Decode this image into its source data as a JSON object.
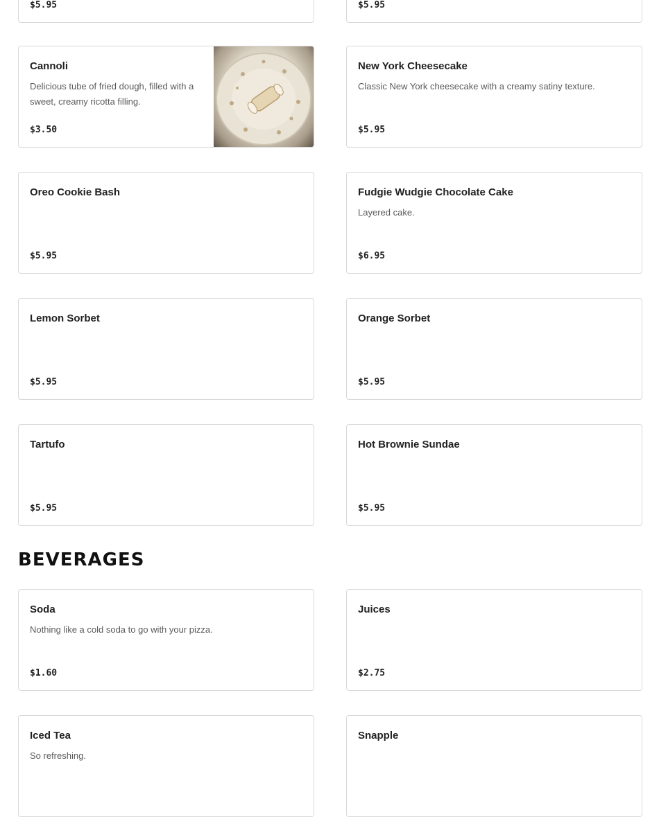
{
  "desserts": {
    "items": [
      {
        "name": "",
        "description": "",
        "price": "$5.95"
      },
      {
        "name": "",
        "description": "",
        "price": "$5.95"
      },
      {
        "name": "Cannoli",
        "description": "Delicious tube of fried dough, filled with a sweet, creamy ricotta filling.",
        "price": "$3.50"
      },
      {
        "name": "New York Cheesecake",
        "description": "Classic New York cheesecake with a creamy satiny texture.",
        "price": "$5.95"
      },
      {
        "name": "Oreo Cookie Bash",
        "description": "",
        "price": "$5.95"
      },
      {
        "name": "Fudgie Wudgie Chocolate Cake",
        "description": "Layered cake.",
        "price": "$6.95"
      },
      {
        "name": "Lemon Sorbet",
        "description": "",
        "price": "$5.95"
      },
      {
        "name": "Orange Sorbet",
        "description": "",
        "price": "$5.95"
      },
      {
        "name": "Tartufo",
        "description": "",
        "price": "$5.95"
      },
      {
        "name": "Hot Brownie Sundae",
        "description": "",
        "price": "$5.95"
      }
    ]
  },
  "beverages": {
    "title": "BEVERAGES",
    "items": [
      {
        "name": "Soda",
        "description": "Nothing like a cold soda to go with your pizza.",
        "price": "$1.60"
      },
      {
        "name": "Juices",
        "description": "",
        "price": "$2.75"
      },
      {
        "name": "Iced Tea",
        "description": "So refreshing.",
        "price": ""
      },
      {
        "name": "Snapple",
        "description": "",
        "price": ""
      }
    ]
  }
}
